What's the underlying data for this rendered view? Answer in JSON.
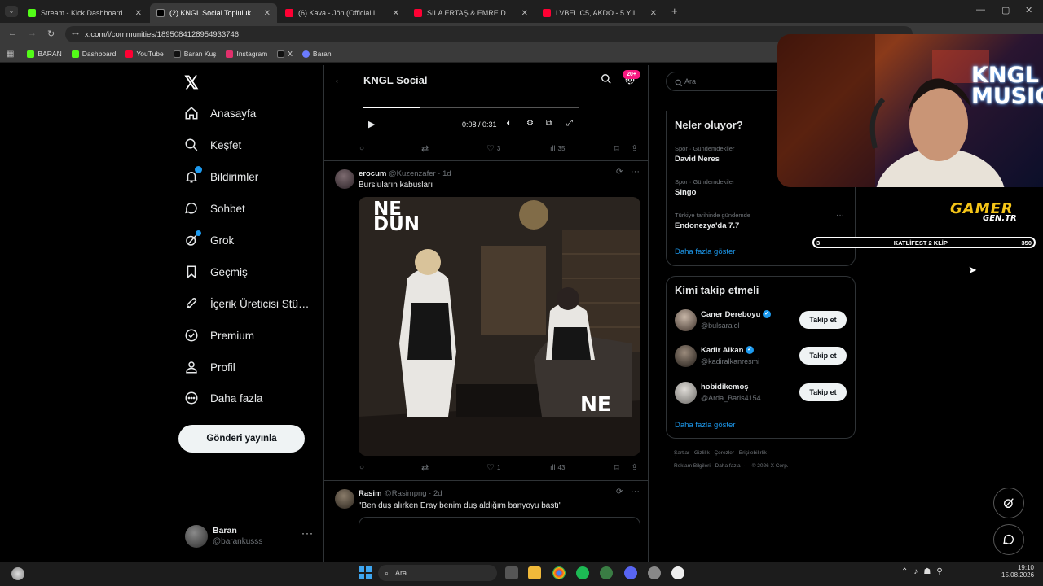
{
  "browser": {
    "tabs": [
      {
        "title": "Stream - Kick Dashboard",
        "color": "#53fc18"
      },
      {
        "title": "(2) KNGL Social Topluluk / X",
        "color": "#ffffff"
      },
      {
        "title": "(6) Kava - Jön (Official Lyric Vid…",
        "color": "#ff0033"
      },
      {
        "title": "SILA ERTAŞ & EMRE DEMİR - Y…",
        "color": "#ff0033"
      },
      {
        "title": "LVBEL C5, AKDO - 5 YILDIZ - Yo…",
        "color": "#ff0033"
      }
    ],
    "url": "x.com/i/communities/1895084128954933746",
    "bookmarks": [
      {
        "label": "BARAN",
        "color": "#53fc18"
      },
      {
        "label": "Dashboard",
        "color": "#53fc18"
      },
      {
        "label": "YouTube",
        "color": "#ff0033"
      },
      {
        "label": "Baran Kuş",
        "color": "#111111"
      },
      {
        "label": "Instagram",
        "color": "#e1306c"
      },
      {
        "label": "X",
        "color": "#111111"
      },
      {
        "label": "Baran",
        "color": "#6b7cff"
      }
    ]
  },
  "nav": {
    "items": [
      {
        "label": "Anasayfa",
        "icon": "home-icon"
      },
      {
        "label": "Keşfet",
        "icon": "search-icon"
      },
      {
        "label": "Bildirimler",
        "icon": "bell-icon"
      },
      {
        "label": "Sohbet",
        "icon": "chat-icon"
      },
      {
        "label": "Grok",
        "icon": "grok-icon"
      },
      {
        "label": "Geçmiş",
        "icon": "bookmark-icon"
      },
      {
        "label": "İçerik Üreticisi Stü…",
        "icon": "rocket-icon"
      },
      {
        "label": "Premium",
        "icon": "premium-icon"
      },
      {
        "label": "Profil",
        "icon": "person-icon"
      },
      {
        "label": "Daha fazla",
        "icon": "more-circle-icon"
      }
    ],
    "post_button": "Gönderi yayınla",
    "user": {
      "name": "Baran",
      "handle": "@barankusss"
    }
  },
  "header": {
    "title": "KNGL Social",
    "badge": "20+"
  },
  "video": {
    "time": "0:08 / 0:31",
    "progress": 0.26
  },
  "posts": [
    {
      "replies": "",
      "reposts": "",
      "likes": "3",
      "views": "35"
    },
    {
      "name": "erocum",
      "handle": "@Kuzenzafer",
      "time": "· 1d",
      "text": "Bursluların kabusları",
      "meme_top": "NE\nDUN",
      "meme_bottom": "NE",
      "likes": "1",
      "views": "43"
    },
    {
      "name": "Rasim",
      "handle": "@Rasimpng",
      "time": "· 2d",
      "text": "\"Ben duş alırken Eray benim duş aldığım banyoyu bastı\""
    }
  ],
  "right": {
    "search_placeholder": "Ara",
    "trends_title": "Neler oluyor?",
    "trends": [
      {
        "context": "Spor · Gündemdekiler",
        "name": "David Neres"
      },
      {
        "context": "Spor · Gündemdekiler",
        "name": "Singo"
      },
      {
        "context": "Türkiye tarihinde gündemde",
        "name": "Endonezya'da 7.7"
      }
    ],
    "show_more": "Daha fazla göster",
    "follow_title": "Kimi takip etmeli",
    "suggestions": [
      {
        "name": "Caner Dereboyu",
        "handle": "@bulsaralol",
        "verified": true
      },
      {
        "name": "Kadir Alkan",
        "handle": "@kadiralkanresmi",
        "verified": true
      },
      {
        "name": "hobidikemoş",
        "handle": "@Arda_Baris4154",
        "verified": false
      }
    ],
    "follow_label": "Takip et",
    "footer_line1": "Şartlar · Gizlilik · Çerezler · Erişilebilirlik ·",
    "footer_line2": "Reklam Bilgileri · Daha fazla ··· · © 2026 X Corp."
  },
  "overlay": {
    "cam_text": "KNGL MUSIC",
    "gamer_line1": "GAMER",
    "gamer_line2": "GEN.TR",
    "goal_left": "3",
    "goal_label": "KATLİFEST 2 KLİP",
    "goal_right": "350"
  },
  "taskbar": {
    "search": "Ara",
    "time": "19:10",
    "date": "15.08.2026"
  }
}
